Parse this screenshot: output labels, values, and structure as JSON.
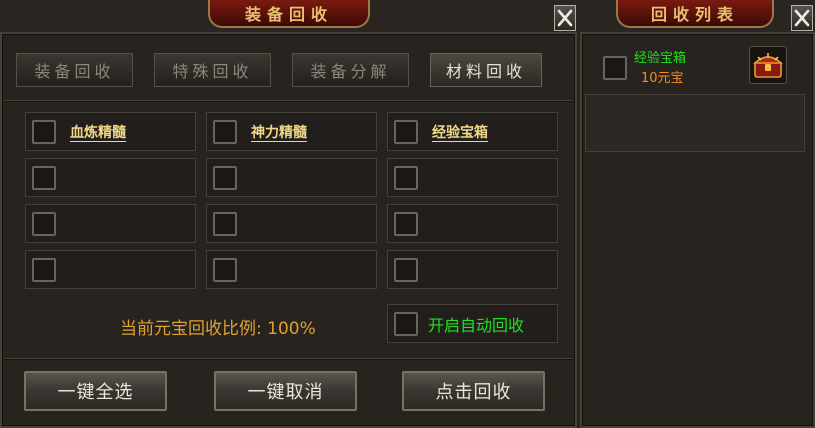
{
  "main": {
    "title": "装备回收",
    "tabs": [
      {
        "label": "装备回收",
        "active": false
      },
      {
        "label": "特殊回收",
        "active": false
      },
      {
        "label": "装备分解",
        "active": false
      },
      {
        "label": "材料回收",
        "active": true
      }
    ],
    "items": [
      {
        "label": "血炼精髓"
      },
      {
        "label": "神力精髓"
      },
      {
        "label": "经验宝箱"
      }
    ],
    "ratio_label": "当前元宝回收比例: ",
    "ratio_value": "100%",
    "auto_recycle_label": "开启自动回收",
    "buttons": {
      "select_all": "一键全选",
      "cancel_all": "一键取消",
      "recycle": "点击回收"
    }
  },
  "side": {
    "title": "回收列表",
    "entries": [
      {
        "name": "经验宝箱",
        "price": "10元宝",
        "icon": "treasure-chest-icon"
      }
    ]
  },
  "colors": {
    "item_label": "#f0d888",
    "green_text": "#20e020",
    "gold_text": "#e0a030",
    "price_text": "#ff8a1a",
    "title_text": "#e8c070"
  }
}
